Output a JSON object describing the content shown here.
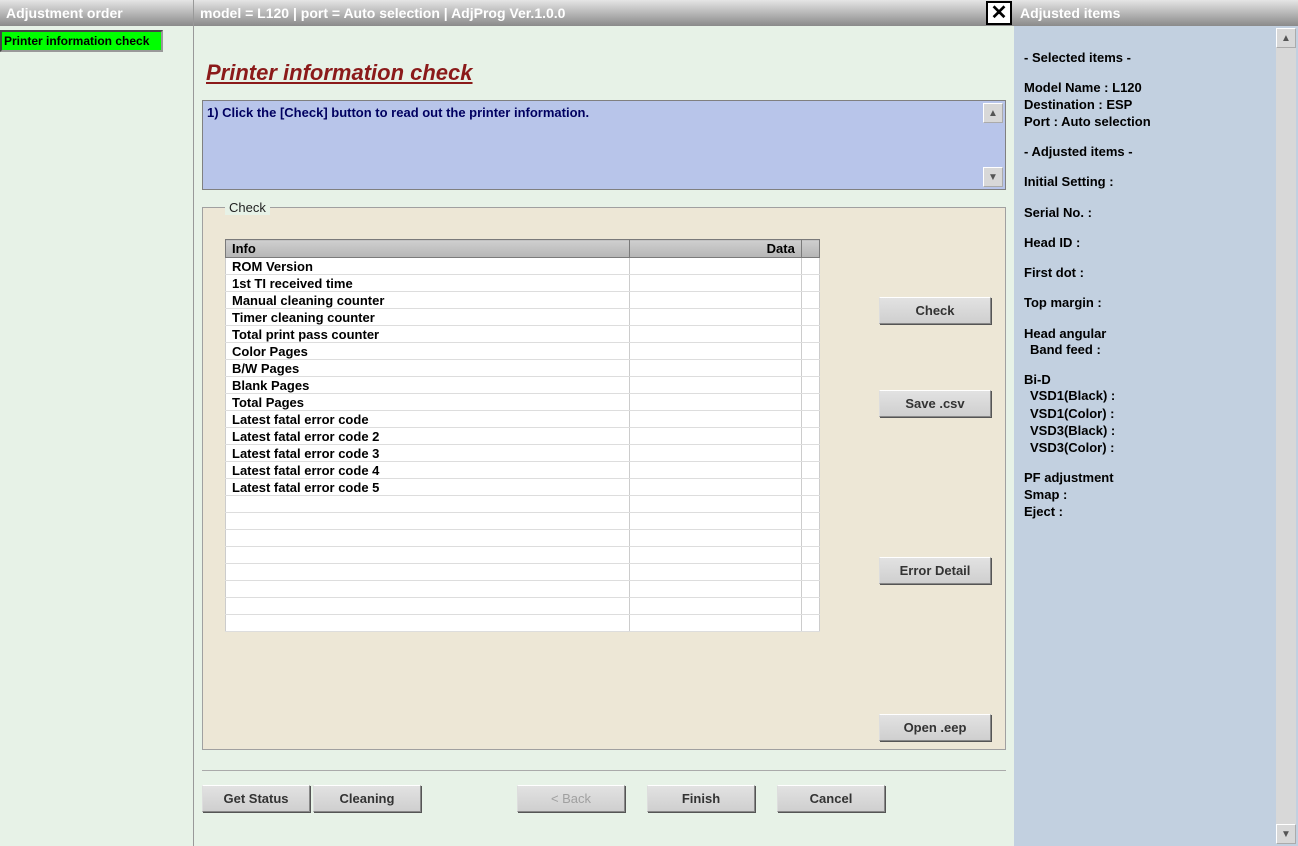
{
  "left": {
    "title": "Adjustment order",
    "selected_item": "Printer information check"
  },
  "center": {
    "title_bar": "model = L120  |  port = Auto selection  |  AdjProg Ver.1.0.0",
    "page_title": "Printer information check",
    "instruction": "1) Click the [Check] button to read out the printer information.",
    "fieldset_label": "Check",
    "table": {
      "col_info": "Info",
      "col_data": "Data",
      "rows": [
        {
          "info": "ROM Version",
          "data": ""
        },
        {
          "info": "1st TI received time",
          "data": ""
        },
        {
          "info": "Manual cleaning counter",
          "data": ""
        },
        {
          "info": "Timer cleaning counter",
          "data": ""
        },
        {
          "info": "Total print pass counter",
          "data": ""
        },
        {
          "info": "Color Pages",
          "data": ""
        },
        {
          "info": "B/W Pages",
          "data": ""
        },
        {
          "info": "Blank Pages",
          "data": ""
        },
        {
          "info": "Total Pages",
          "data": ""
        },
        {
          "info": "Latest fatal error code",
          "data": ""
        },
        {
          "info": "Latest fatal error code 2",
          "data": ""
        },
        {
          "info": "Latest fatal error code 3",
          "data": ""
        },
        {
          "info": "Latest fatal error code 4",
          "data": ""
        },
        {
          "info": "Latest fatal error code 5",
          "data": ""
        },
        {
          "info": "",
          "data": ""
        },
        {
          "info": "",
          "data": ""
        },
        {
          "info": "",
          "data": ""
        },
        {
          "info": "",
          "data": ""
        },
        {
          "info": "",
          "data": ""
        },
        {
          "info": "",
          "data": ""
        },
        {
          "info": "",
          "data": ""
        },
        {
          "info": "",
          "data": ""
        }
      ]
    },
    "buttons": {
      "check": "Check",
      "save_csv": "Save .csv",
      "error_detail": "Error Detail",
      "open_eep": "Open .eep",
      "get_status": "Get Status",
      "cleaning": "Cleaning",
      "back": "< Back",
      "finish": "Finish",
      "cancel": "Cancel"
    }
  },
  "right": {
    "title": "Adjusted items",
    "selected_items_header": "- Selected items -",
    "model_name": "Model Name : L120",
    "destination": "Destination : ESP",
    "port": "Port : Auto selection",
    "adjusted_items_header": "- Adjusted items -",
    "initial_setting": "Initial Setting :",
    "serial_no": "Serial No. :",
    "head_id": "Head ID :",
    "first_dot": "First dot :",
    "top_margin": "Top margin :",
    "head_angular": "Head angular",
    "band_feed": "Band feed :",
    "bi_d": "Bi-D",
    "vsd1_black": "VSD1(Black) :",
    "vsd1_color": "VSD1(Color) :",
    "vsd3_black": "VSD3(Black) :",
    "vsd3_color": "VSD3(Color) :",
    "pf_adjustment": "PF adjustment",
    "smap": "Smap :",
    "eject": "Eject :"
  }
}
